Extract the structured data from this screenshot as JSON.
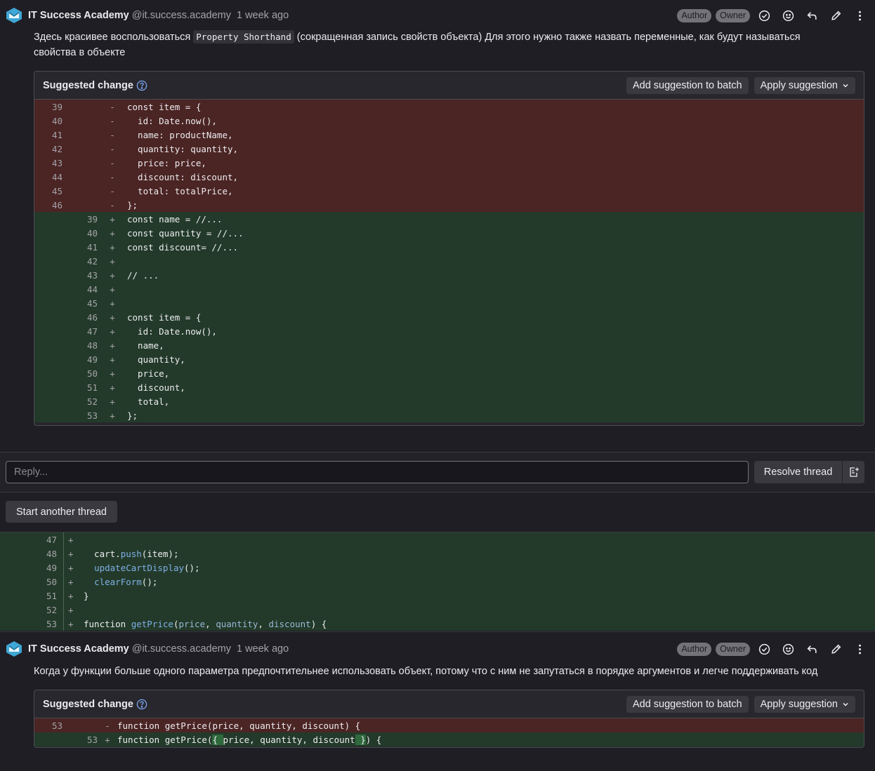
{
  "note1": {
    "author_name": "IT Success Academy",
    "author_handle": "@it.success.academy",
    "time": "1 week ago",
    "badge_author": "Author",
    "badge_owner": "Owner",
    "text_before": "Здесь красивее воспользоваться ",
    "inline_code": "Property Shorthand",
    "text_after": " (сокращенная запись свойств объекта) Для этого нужно также назвать переменные, как будут называться свойства в объекте",
    "suggestion": {
      "title": "Suggested change",
      "add_batch": "Add suggestion to batch",
      "apply": "Apply suggestion",
      "removed": [
        {
          "ln": "39",
          "code": "const item = {"
        },
        {
          "ln": "40",
          "code": "  id: Date.now(),"
        },
        {
          "ln": "41",
          "code": "  name: productName,"
        },
        {
          "ln": "42",
          "code": "  quantity: quantity,"
        },
        {
          "ln": "43",
          "code": "  price: price,"
        },
        {
          "ln": "44",
          "code": "  discount: discount,"
        },
        {
          "ln": "45",
          "code": "  total: totalPrice,"
        },
        {
          "ln": "46",
          "code": "};"
        }
      ],
      "added": [
        {
          "ln": "39",
          "code": "const name = //..."
        },
        {
          "ln": "40",
          "code": "const quantity = //..."
        },
        {
          "ln": "41",
          "code": "const discount= //..."
        },
        {
          "ln": "42",
          "code": ""
        },
        {
          "ln": "43",
          "code": "// ..."
        },
        {
          "ln": "44",
          "code": ""
        },
        {
          "ln": "45",
          "code": ""
        },
        {
          "ln": "46",
          "code": "const item = {"
        },
        {
          "ln": "47",
          "code": "  id: Date.now(),"
        },
        {
          "ln": "48",
          "code": "  name,"
        },
        {
          "ln": "49",
          "code": "  quantity,"
        },
        {
          "ln": "50",
          "code": "  price,"
        },
        {
          "ln": "51",
          "code": "  discount,"
        },
        {
          "ln": "52",
          "code": "  total,"
        },
        {
          "ln": "53",
          "code": "};"
        }
      ]
    }
  },
  "reply": {
    "placeholder": "Reply...",
    "resolve": "Resolve thread"
  },
  "start_thread": "Start another thread",
  "context_diff": [
    {
      "ln": "47",
      "parts": []
    },
    {
      "ln": "48",
      "parts": [
        {
          "t": "  cart.",
          "c": ""
        },
        {
          "t": "push",
          "c": "fn"
        },
        {
          "t": "(item);",
          "c": ""
        }
      ]
    },
    {
      "ln": "49",
      "parts": [
        {
          "t": "  ",
          "c": ""
        },
        {
          "t": "updateCartDisplay",
          "c": "fn"
        },
        {
          "t": "();",
          "c": ""
        }
      ]
    },
    {
      "ln": "50",
      "parts": [
        {
          "t": "  ",
          "c": ""
        },
        {
          "t": "clearForm",
          "c": "fn"
        },
        {
          "t": "();",
          "c": ""
        }
      ]
    },
    {
      "ln": "51",
      "parts": [
        {
          "t": "}",
          "c": ""
        }
      ]
    },
    {
      "ln": "52",
      "parts": []
    },
    {
      "ln": "53",
      "parts": [
        {
          "t": "function ",
          "c": ""
        },
        {
          "t": "getPrice",
          "c": "fn"
        },
        {
          "t": "(",
          "c": ""
        },
        {
          "t": "price",
          "c": "pm"
        },
        {
          "t": ", ",
          "c": ""
        },
        {
          "t": "quantity",
          "c": "pm"
        },
        {
          "t": ", ",
          "c": ""
        },
        {
          "t": "discount",
          "c": "pm"
        },
        {
          "t": ") {",
          "c": ""
        }
      ]
    }
  ],
  "note2": {
    "author_name": "IT Success Academy",
    "author_handle": "@it.success.academy",
    "time": "1 week ago",
    "badge_author": "Author",
    "badge_owner": "Owner",
    "text": "Когда у функции больше одного параметра предпочтительнее использовать объект, потому что с ним не запутаться в порядке аргументов и легче поддерживать код",
    "suggestion": {
      "title": "Suggested change",
      "add_batch": "Add suggestion to batch",
      "apply": "Apply suggestion",
      "removed_ln": "53",
      "removed_code": "function getPrice(price, quantity, discount) {",
      "added_ln": "53",
      "added_code_a": "function getPrice(",
      "added_code_b": "{ ",
      "added_code_c": "price, quantity, discount",
      "added_code_d": " }",
      "added_code_e": ") {"
    }
  }
}
